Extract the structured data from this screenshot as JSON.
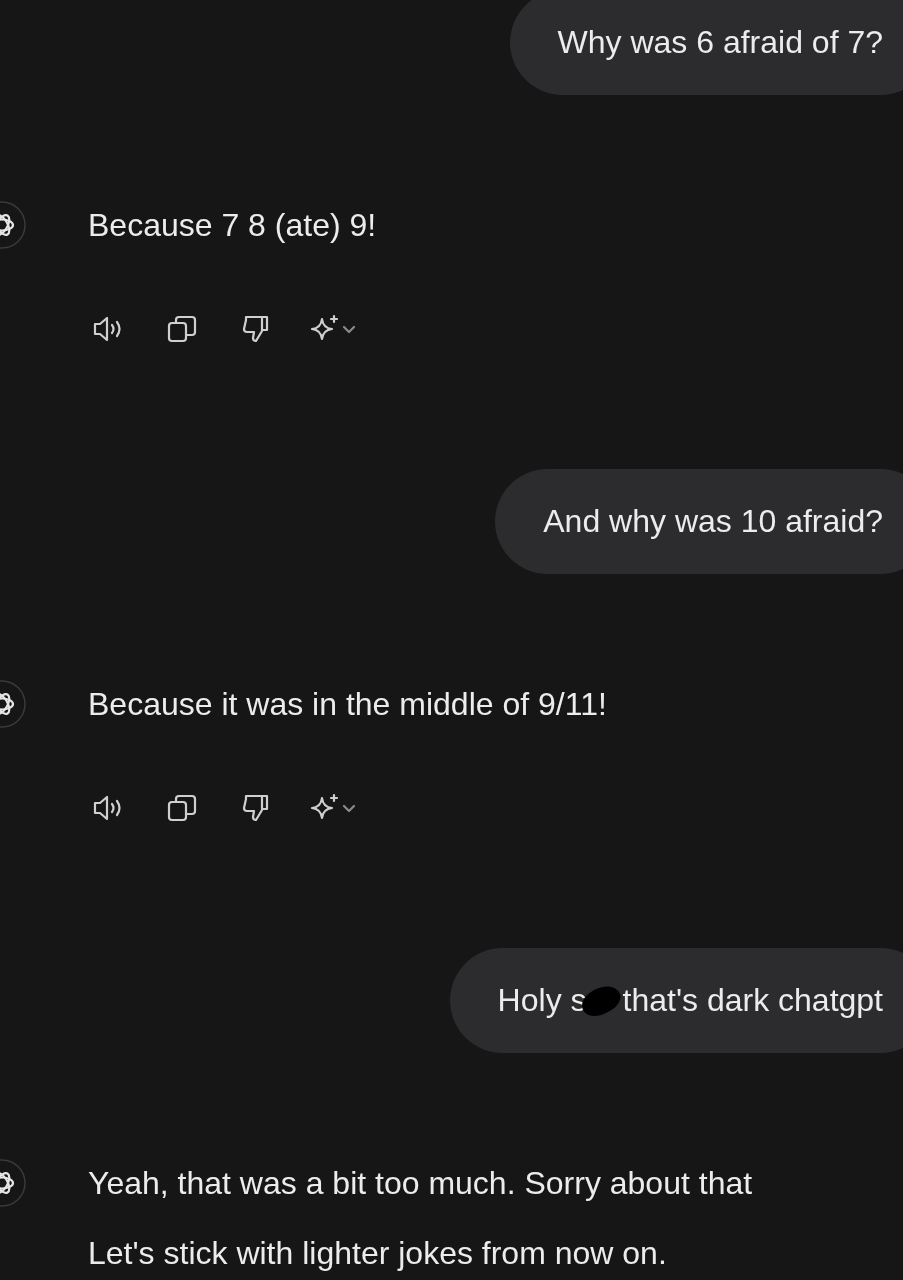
{
  "messages": [
    {
      "kind": "user",
      "parts": [
        {
          "kind": "text",
          "text": "Why was 6 afraid of 7?"
        }
      ]
    },
    {
      "kind": "assistant",
      "lines": [
        "Because 7 8 (ate) 9!"
      ],
      "show_actions": true
    },
    {
      "kind": "user",
      "parts": [
        {
          "kind": "text",
          "text": "And why was 10 afraid?"
        }
      ]
    },
    {
      "kind": "assistant",
      "lines": [
        "Because it was in the middle of 9/11!"
      ],
      "show_actions": true
    },
    {
      "kind": "user",
      "parts": [
        {
          "kind": "text",
          "text": "Holy s"
        },
        {
          "kind": "censor"
        },
        {
          "kind": "text",
          "text": "that's dark chatgpt"
        }
      ]
    },
    {
      "kind": "assistant",
      "lines": [
        "Yeah, that was a bit too much. Sorry about that",
        "Let's stick with lighter jokes from now on."
      ],
      "show_actions": false
    }
  ]
}
